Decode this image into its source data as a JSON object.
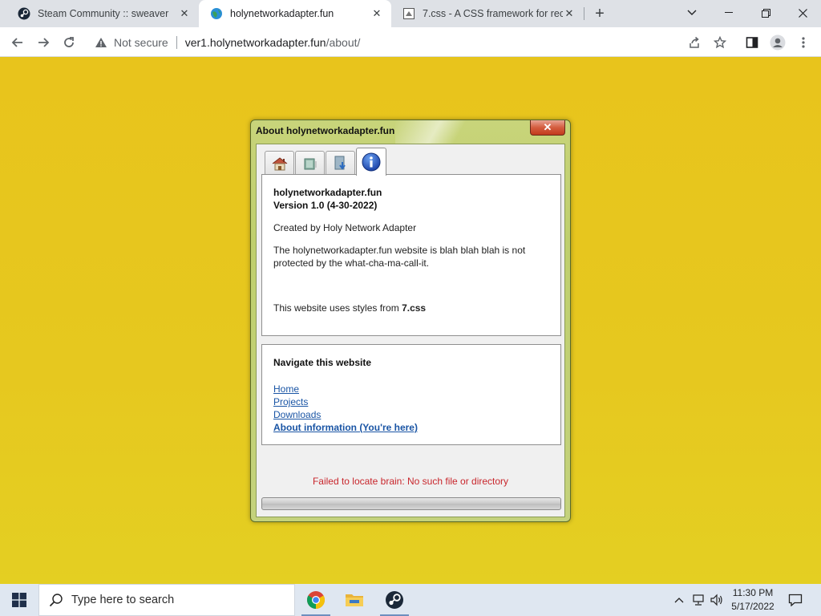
{
  "browser": {
    "tabs": [
      {
        "title": "Steam Community :: sweaver",
        "active": false
      },
      {
        "title": "holynetworkadapter.fun",
        "active": true
      },
      {
        "title": "7.css - A CSS framework for recre",
        "active": false
      }
    ],
    "security_label": "Not secure",
    "url_host": "ver1.holynetworkadapter.fun",
    "url_path": "/about/"
  },
  "window": {
    "title": "About holynetworkadapter.fun",
    "close_glyph": "✕",
    "tab_icons": [
      "home-icon",
      "projects-icon",
      "downloads-icon",
      "info-icon"
    ],
    "about": {
      "name": "holynetworkadapter.fun",
      "version": "Version 1.0 (4-30-2022)",
      "created_by": "Created by Holy Network Adapter",
      "description": "The holynetworkadapter.fun website is blah blah blah is not protected by the what-cha-ma-call-it.",
      "styles_prefix": "This website uses styles from ",
      "styles_name": "7.css"
    },
    "nav": {
      "heading": "Navigate this website",
      "links": [
        "Home",
        "Projects",
        "Downloads",
        "About information (You're here)"
      ]
    },
    "error_message": "Failed to locate brain: No such file or directory",
    "progress": 0
  },
  "taskbar": {
    "search_placeholder": "Type here to search",
    "apps": [
      "chrome-icon",
      "file-explorer-icon",
      "steam-icon"
    ],
    "time": "11:30 PM",
    "date": "5/17/2022"
  },
  "colors": {
    "page_background": "#e6c81f",
    "error_text": "#c8262c",
    "link": "#1a55a5"
  }
}
